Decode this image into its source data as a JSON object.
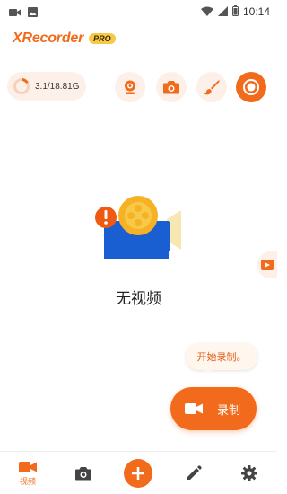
{
  "status_bar": {
    "time": "10:14",
    "icons": [
      "video-notification-icon",
      "image-notification-icon",
      "wifi-icon",
      "signal-icon",
      "battery-icon"
    ]
  },
  "header": {
    "app_name": "XRecorder",
    "badge": "PRO"
  },
  "storage": {
    "text": "3.1/18.81G",
    "used_fraction": 0.165
  },
  "toolbar": {
    "buttons": [
      {
        "icon": "facecam-icon",
        "active": false
      },
      {
        "icon": "screenshot-camera-icon",
        "active": false
      },
      {
        "icon": "brush-icon",
        "active": false
      },
      {
        "icon": "record-circle-icon",
        "active": true
      }
    ]
  },
  "main": {
    "empty_text": "无视频",
    "illustration": "film-camera-icon"
  },
  "floating": {
    "tooltip": "开始录制。",
    "record_label": "录制"
  },
  "bottom_nav": {
    "items": [
      {
        "label": "视频",
        "icon": "video-icon",
        "active": true
      },
      {
        "label": "",
        "icon": "camera-icon",
        "active": false
      },
      {
        "label": "",
        "icon": "plus-icon",
        "active": false
      },
      {
        "label": "",
        "icon": "pencil-icon",
        "active": false
      },
      {
        "label": "",
        "icon": "settings-gear-icon",
        "active": false
      }
    ]
  },
  "colors": {
    "accent": "#f26b1d",
    "accent_light": "#fdf0e8",
    "badge": "#f7c948",
    "illustration_blue": "#1a5fd1",
    "illustration_yellow": "#f7b125"
  }
}
